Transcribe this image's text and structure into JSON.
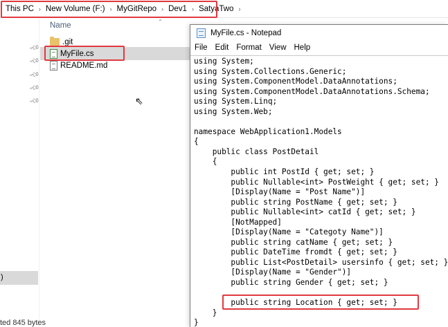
{
  "explorer": {
    "breadcrumb": [
      "This PC",
      "New Volume (F:)",
      "MyGitRepo",
      "Dev1",
      "SatyaTwo"
    ],
    "breadcrumb_separator": "›",
    "column_header": "Name",
    "files": [
      {
        "name": ".git",
        "icon": "folder-icon",
        "selected": false
      },
      {
        "name": "MyFile.cs",
        "icon": "cs-file-icon",
        "selected": true
      },
      {
        "name": "README.md",
        "icon": "document-icon",
        "selected": false
      }
    ],
    "nav_selected_label": ")",
    "status_text": "ted  845 bytes"
  },
  "notepad": {
    "title": "MyFile.cs - Notepad",
    "menu": [
      "File",
      "Edit",
      "Format",
      "View",
      "Help"
    ],
    "code_lines": [
      "using System;",
      "using System.Collections.Generic;",
      "using System.ComponentModel.DataAnnotations;",
      "using System.ComponentModel.DataAnnotations.Schema;",
      "using System.Linq;",
      "using System.Web;",
      "",
      "namespace WebApplication1.Models",
      "{",
      "    public class PostDetail",
      "    {",
      "        public int PostId { get; set; }",
      "        public Nullable<int> PostWeight { get; set; }",
      "        [Display(Name = \"Post Name\")]",
      "        public string PostName { get; set; }",
      "        public Nullable<int> catId { get; set; }",
      "        [NotMapped]",
      "        [Display(Name = \"Categoty Name\")]",
      "        public string catName { get; set; }",
      "        public DateTime fromdt { get; set; }",
      "        public List<PostDetail> usersinfo { get; set; }",
      "        [Display(Name = \"Gender\")]",
      "        public string Gender { get; set; }",
      "",
      "        public string Location { get; set; }",
      "    }",
      "}"
    ]
  },
  "colors": {
    "highlight_border": "#e0393e",
    "selection_bg": "#d9d9d9",
    "folder": "#e8c36a"
  }
}
